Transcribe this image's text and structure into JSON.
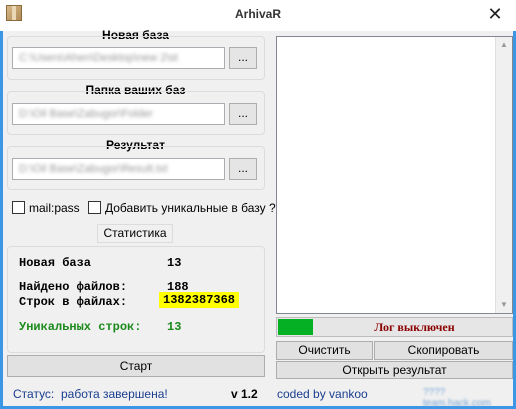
{
  "window": {
    "title": "ArhivaR",
    "close_glyph": "✕"
  },
  "new_base": {
    "label": "Новая база",
    "path": "C:\\Users\\Ahen\\Desktop\\new 2\\st",
    "browse": "..."
  },
  "folder": {
    "label": "Папка ваших баз",
    "path": "D:\\Oil Base\\Zabugor\\Folder",
    "browse": "..."
  },
  "result": {
    "label": "Результат",
    "path": "D:\\Oil Base\\Zabugor\\Result.txt",
    "browse": "..."
  },
  "options": {
    "mailpass": "mail:pass",
    "add_unique": "Добавить уникальные в базу ?"
  },
  "stats": {
    "title": "Статистика",
    "new_base_label": "Новая база",
    "new_base_value": "13",
    "files_found_label": "Найдено файлов:",
    "files_found_value": "188",
    "lines_label": "Строк в файлах:",
    "lines_value": "1382387368",
    "unique_label": "Уникальных строк:",
    "unique_value": "13"
  },
  "buttons": {
    "start": "Старт",
    "clear": "Очистить",
    "copy": "Скопировать",
    "open_result": "Открыть результат"
  },
  "log": {
    "status": "Лог выключен",
    "progress_fraction": 0.15
  },
  "status_bar": {
    "status_label": "Статус:",
    "status_value": "работа завершена!",
    "version": "v 1.2",
    "credit": "coded by vankoo",
    "watermark": "????team.hack.com"
  },
  "colors": {
    "accent_border": "#3c96e6",
    "highlight": "#ffff00",
    "green_text": "#1a8a1a",
    "log_status": "#8b0000",
    "progress": "#06b025"
  }
}
